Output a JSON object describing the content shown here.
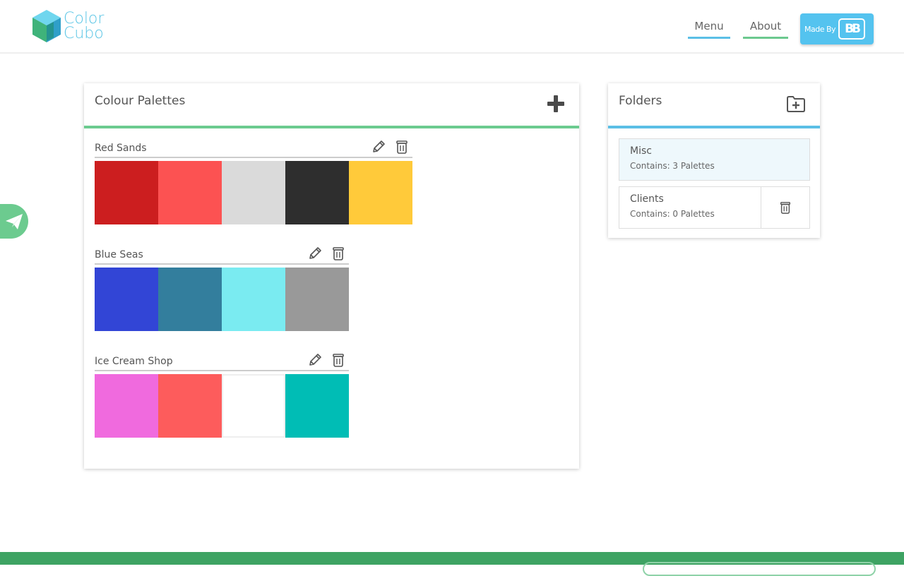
{
  "app": {
    "logo_line1": "Color",
    "logo_line2": "Cubo"
  },
  "nav": {
    "menu_label": "Menu",
    "about_label": "About",
    "madeby_label": "Made By",
    "madeby_logo": "BB"
  },
  "palettes": {
    "title": "Colour Palettes",
    "items": [
      {
        "name": "Red Sands",
        "colors": [
          "#cc1e1f",
          "#fc5252",
          "#dadada",
          "#2e2e2e",
          "#ffca3a"
        ]
      },
      {
        "name": "Blue Seas",
        "colors": [
          "#3245d6",
          "#337e9d",
          "#7aebf1",
          "#999999"
        ]
      },
      {
        "name": "Ice Cream Shop",
        "colors": [
          "#f06ade",
          "#fd5c5c",
          "#ffffff",
          "#00bdb5"
        ]
      }
    ]
  },
  "folders": {
    "title": "Folders",
    "items": [
      {
        "name": "Misc",
        "count": "Contains: 3 Palettes"
      },
      {
        "name": "Clients",
        "count": "Contains: 0 Palettes"
      }
    ]
  },
  "colors": {
    "green_accent": "#6ccb8f",
    "blue_accent": "#5bbfe6",
    "footer_green": "#3ea363"
  }
}
